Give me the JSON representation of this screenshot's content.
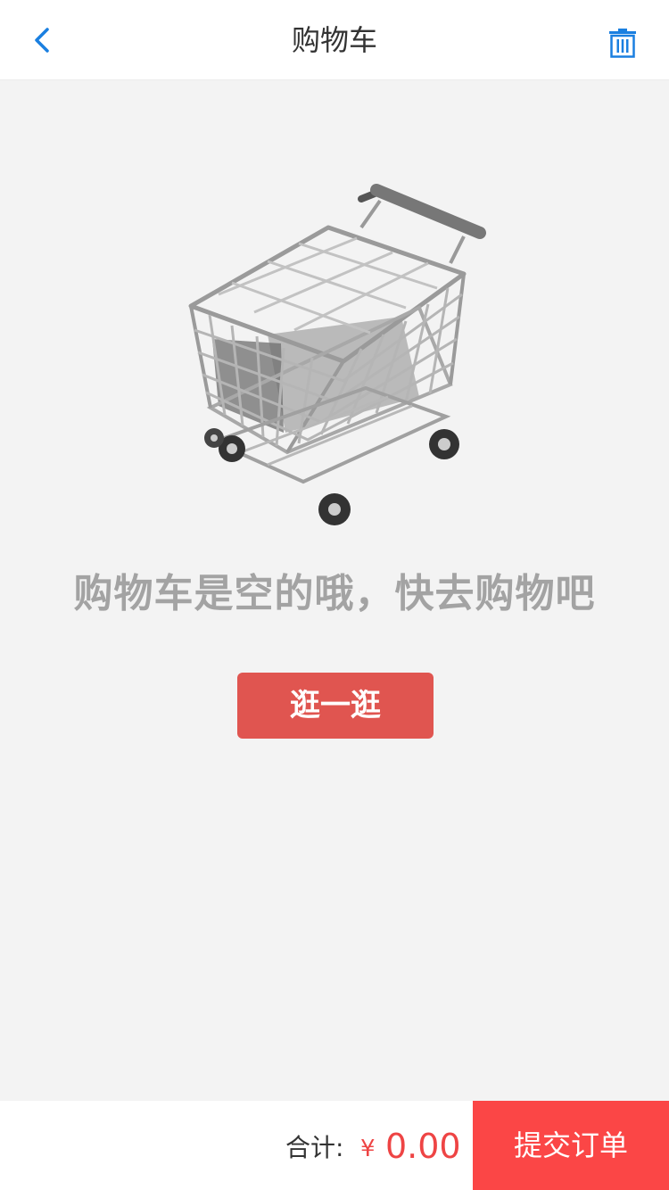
{
  "header": {
    "title": "购物车",
    "back_icon": "chevron-left-icon",
    "trash_icon": "trash-icon",
    "accent_color": "#1a7fe0"
  },
  "empty_state": {
    "illustration": "shopping-cart-icon",
    "message": "购物车是空的哦，快去购物吧",
    "browse_button_label": "逛一逛",
    "browse_button_color": "#e05550"
  },
  "footer": {
    "total_label": "合计:",
    "currency_symbol": "¥",
    "total_amount": "0.00",
    "submit_label": "提交订单",
    "price_color": "#ee4444",
    "submit_color": "#fb4646"
  }
}
